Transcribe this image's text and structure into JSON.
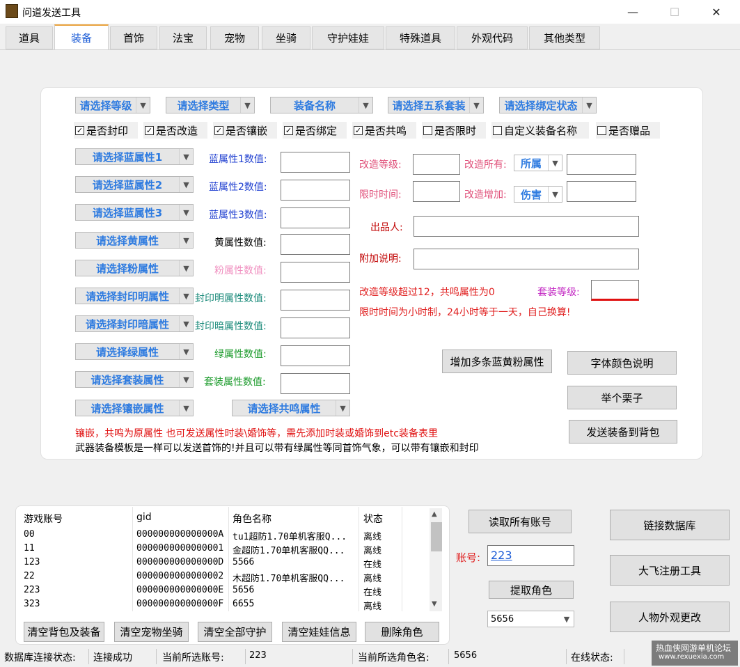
{
  "window": {
    "title": "问道发送工具",
    "min": "—",
    "max": "☐",
    "close": "✕"
  },
  "tabs": [
    "道具",
    "装备",
    "首饰",
    "法宝",
    "宠物",
    "坐骑",
    "守护娃娃",
    "特殊道具",
    "外观代码",
    "其他类型"
  ],
  "top_selects": [
    "请选择等级",
    "请选择类型",
    "装备名称",
    "请选择五系套装",
    "请选择绑定状态"
  ],
  "checkboxes": [
    {
      "label": "是否封印",
      "checked": "✓"
    },
    {
      "label": "是否改造",
      "checked": "✓"
    },
    {
      "label": "是否镶嵌",
      "checked": "✓"
    },
    {
      "label": "是否绑定",
      "checked": "✓"
    },
    {
      "label": "是否共鸣",
      "checked": "✓"
    },
    {
      "label": "是否限时",
      "checked": ""
    },
    {
      "label": "自定义装备名称",
      "checked": ""
    },
    {
      "label": "是否赠品",
      "checked": ""
    }
  ],
  "attr_rows": [
    {
      "select": "请选择蓝属性1",
      "label": "蓝属性1数值:",
      "color": "#1f3fd0"
    },
    {
      "select": "请选择蓝属性2",
      "label": "蓝属性2数值:",
      "color": "#1f3fd0"
    },
    {
      "select": "请选择蓝属性3",
      "label": "蓝属性3数值:",
      "color": "#1f3fd0"
    },
    {
      "select": "请选择黄属性",
      "label": "黄属性数值:",
      "color": "#000000"
    },
    {
      "select": "请选择粉属性",
      "label": "粉属性数值:",
      "color": "#f090c0"
    },
    {
      "select": "请选择封印明属性",
      "label": "封印明属性数值:",
      "color": "#1a8a7a"
    },
    {
      "select": "请选择封印暗属性",
      "label": "封印暗属性数值:",
      "color": "#1a8a7a"
    },
    {
      "select": "请选择绿属性",
      "label": "绿属性数值:",
      "color": "#1a9a2a"
    },
    {
      "select": "请选择套装属性",
      "label": "套装属性数值:",
      "color": "#1a9a2a"
    }
  ],
  "inlay_select": "请选择镶嵌属性",
  "resonance_select": "请选择共鸣属性",
  "right": {
    "modify_level": "改造等级:",
    "modify_all": "改造所有:",
    "modify_all_value": "所属",
    "limit_time": "限时时间:",
    "modify_add": "改造增加:",
    "modify_add_value": "伤害",
    "producer": "出品人:",
    "extra_note": "附加说明:",
    "warn1": "改造等级超过12，共鸣属性为0",
    "suit_level": "套装等级:",
    "warn2": "限时时间为小时制，24小时等于一天，自己换算!"
  },
  "buttons": {
    "add_multi": "增加多条蓝黄粉属性",
    "font_color": "字体颜色说明",
    "example": "举个栗子",
    "send_equip": "发送装备到背包"
  },
  "notes": {
    "red": "镶嵌，共鸣为原属性   也可发送属性时装\\婚饰等，需先添加时装或婚饰到etc装备表里",
    "black": "武器装备模板是一样可以发送首饰的!并且可以带有绿属性等同首饰气象，可以带有镶嵌和封印"
  },
  "table": {
    "headers": [
      "游戏账号",
      "gid",
      "角色名称",
      "状态"
    ],
    "rows": [
      [
        "00",
        "000000000000000A",
        "tu1超防1.70单机客服Q...",
        "离线"
      ],
      [
        "11",
        "0000000000000001",
        "金超防1.70单机客服QQ...",
        "离线"
      ],
      [
        "123",
        "000000000000000D",
        "5566",
        "在线"
      ],
      [
        "22",
        "0000000000000002",
        "木超防1.70单机客服QQ...",
        "离线"
      ],
      [
        "223",
        "000000000000000E",
        "5656",
        "在线"
      ],
      [
        "323",
        "000000000000000F",
        "6655",
        "离线"
      ]
    ]
  },
  "bottom_buttons": [
    "清空背包及装备",
    "清空宠物坐骑",
    "清空全部守护",
    "清空娃娃信息",
    "删除角色"
  ],
  "account": {
    "read_all": "读取所有账号",
    "label": "账号:",
    "value": "223",
    "fetch_role": "提取角色",
    "role_select": "5656"
  },
  "side_buttons": [
    "链接数据库",
    "大飞注册工具",
    "人物外观更改"
  ],
  "status": {
    "db_label": "数据库连接状态:",
    "db_value": "连接成功",
    "acc_label": "当前所选账号:",
    "acc_value": "223",
    "role_label": "当前所选角色名:",
    "role_value": "5656",
    "online_label": "在线状态:"
  },
  "watermark": {
    "line1": "热血侠网游单机论坛",
    "line2": "www.rexuexia.com"
  }
}
